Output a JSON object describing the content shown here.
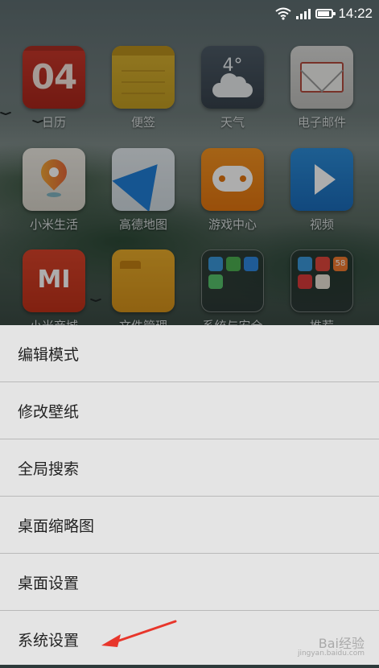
{
  "status_bar": {
    "time": "14:22",
    "icons": [
      "wifi-icon",
      "signal-icon",
      "battery-icon"
    ]
  },
  "apps": [
    {
      "label": "日历",
      "icon": "calendar-icon",
      "badge": "04"
    },
    {
      "label": "便签",
      "icon": "notes-icon"
    },
    {
      "label": "天气",
      "icon": "weather-icon",
      "temp": "4°"
    },
    {
      "label": "电子邮件",
      "icon": "mail-icon"
    },
    {
      "label": "小米生活",
      "icon": "map-pin-icon"
    },
    {
      "label": "高德地图",
      "icon": "navigation-arrow-icon"
    },
    {
      "label": "游戏中心",
      "icon": "gamepad-icon"
    },
    {
      "label": "视频",
      "icon": "play-icon"
    },
    {
      "label": "小米商城",
      "icon": "mi-logo-icon",
      "logo": "MI"
    },
    {
      "label": "文件管理",
      "icon": "folder-icon"
    },
    {
      "label": "系统与安全",
      "icon": "app-folder-icon"
    },
    {
      "label": "推荐",
      "icon": "app-folder-icon",
      "mini_label": "58"
    }
  ],
  "menu": {
    "items": [
      {
        "label": "编辑模式"
      },
      {
        "label": "修改壁纸"
      },
      {
        "label": "全局搜索"
      },
      {
        "label": "桌面缩略图"
      },
      {
        "label": "桌面设置"
      },
      {
        "label": "系统设置"
      }
    ]
  },
  "annotation": {
    "arrow_color": "#e8362b"
  },
  "watermark": {
    "text": "Bai经验",
    "sub": "jingyan.baidu.com"
  },
  "colors": {
    "menu_bg": "#e4e4e4",
    "menu_divider": "#b9b9b9"
  }
}
